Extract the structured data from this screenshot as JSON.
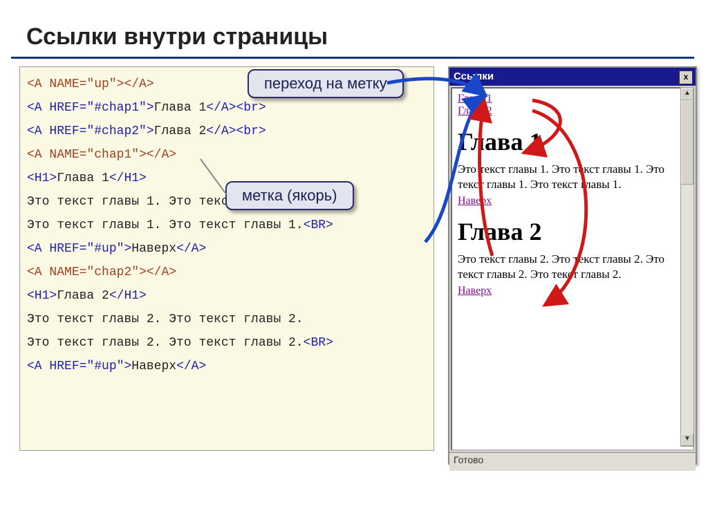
{
  "title": "Ссылки внутри страницы",
  "callouts": {
    "jump": "переход на метку",
    "anchor": "метка (якорь)"
  },
  "code": {
    "l1a": "<A",
    "l1b": " NAME",
    "l1c": "=",
    "l1d": "\"up\"",
    "l1e": "></A>",
    "l2a": "<A",
    "l2b": " HREF",
    "l2c": "=",
    "l2d": "\"#chap1\"",
    "l2e": ">",
    "l2t": "Глава 1",
    "l2f": "</A><br>",
    "l3a": "<A",
    "l3b": " HREF",
    "l3c": "=",
    "l3d": "\"#chap2\"",
    "l3e": ">",
    "l3t": "Глава 2",
    "l3f": "</A><br>",
    "l4a": "<A",
    "l4b": " NAME",
    "l4c": "=",
    "l4d": "\"chap1\"",
    "l4e": "></A>",
    "l5a": "<H1>",
    "l5t": "Глава 1",
    "l5b": "</H1>",
    "l6": "Это текст главы 1. Это текст главы 1.",
    "l7": "Это текст главы 1. Это текст главы 1.",
    "l7b": "<BR>",
    "l8a": "<A",
    "l8b": " HREF",
    "l8c": "=",
    "l8d": "\"#up\"",
    "l8e": ">",
    "l8t": "Наверх",
    "l8f": "</A>",
    "l9a": "<A",
    "l9b": " NAME",
    "l9c": "=",
    "l9d": "\"chap2\"",
    "l9e": "></A>",
    "l10a": "<H1>",
    "l10t": "Глава 2",
    "l10b": "</H1>",
    "l11": "Это текст главы 2. Это текст главы 2.",
    "l12": "Это текст главы 2. Это текст главы 2.",
    "l12b": "<BR>",
    "l13a": "<A",
    "l13b": " HREF",
    "l13c": "=",
    "l13d": "\"#up\"",
    "l13e": ">",
    "l13t": "Наверх",
    "l13f": "</A>"
  },
  "browser": {
    "title": "Ссылки",
    "link1": "Глава 1",
    "link2": "Глава 2",
    "h1a": "Глава 1",
    "p1": "Это текст главы 1. Это текст главы 1. Это текст главы 1. Это текст главы 1.",
    "up1": "Наверх",
    "h1b": "Глава 2",
    "p2": "Это текст главы 2. Это текст главы 2. Это текст главы 2. Это текст главы 2.",
    "up2": "Наверх",
    "status": "Готово",
    "close": "x"
  }
}
